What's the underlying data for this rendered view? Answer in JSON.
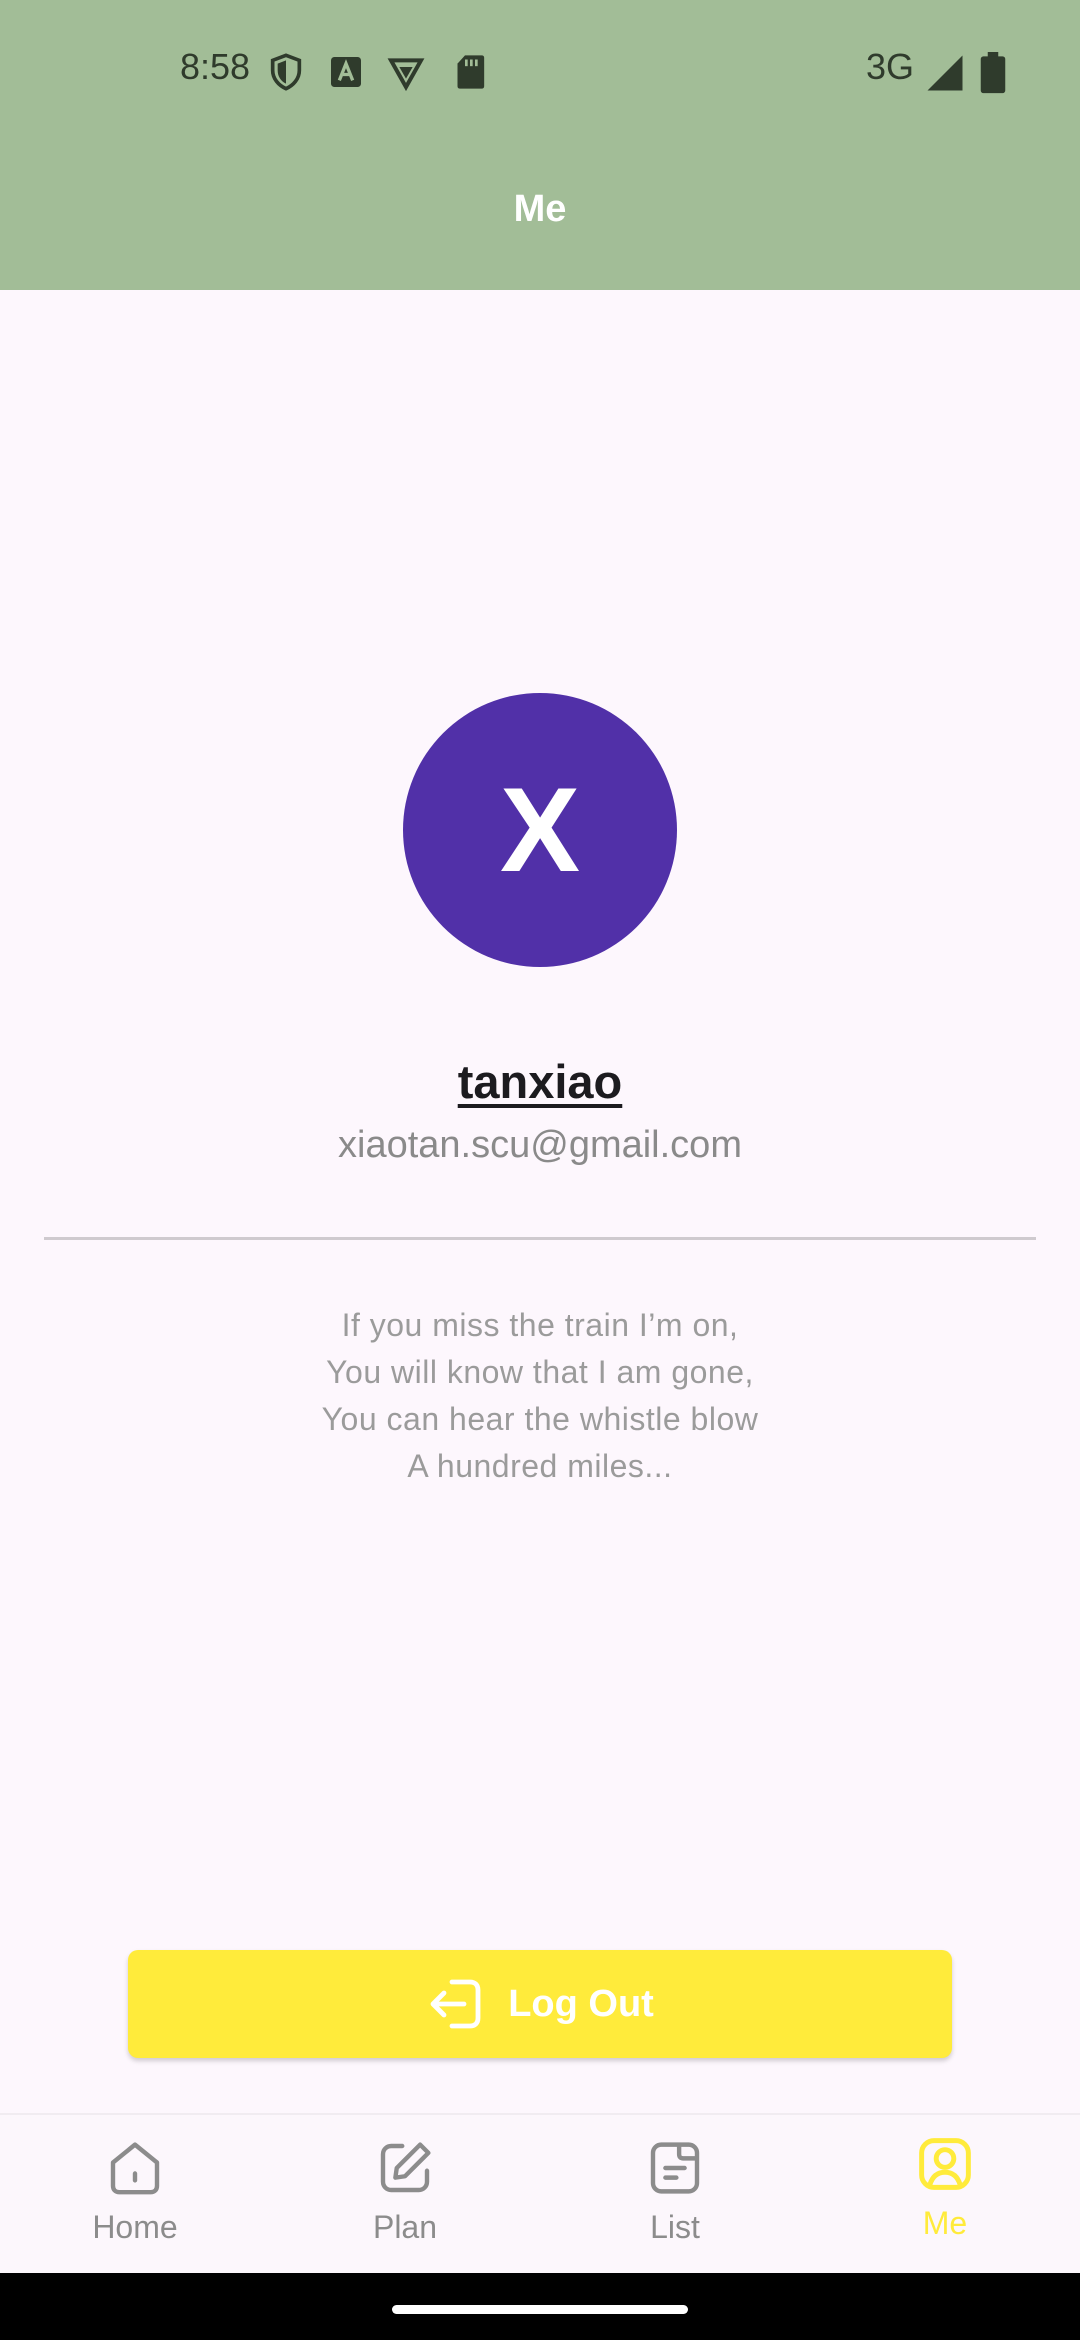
{
  "status_bar": {
    "time": "8:58",
    "network": "3G",
    "icons": [
      "shield-icon",
      "a-badge-icon",
      "vpn-icon",
      "sd-card-icon",
      "signal-icon",
      "battery-icon"
    ]
  },
  "app_bar": {
    "title": "Me"
  },
  "profile": {
    "avatar_letter": "X",
    "avatar_color": "#5130a8",
    "username": "tanxiao",
    "email": "xiaotan.scu@gmail.com"
  },
  "quote": {
    "lines": [
      "If you miss the train I’m on,",
      "You will know that I am gone,",
      "You can hear the whistle blow",
      "A hundred miles..."
    ]
  },
  "logout": {
    "label": "Log Out",
    "icon": "logout-icon",
    "color": "#ffeb3b"
  },
  "bottom_nav": {
    "items": [
      {
        "label": "Home",
        "icon": "home-icon"
      },
      {
        "label": "Plan",
        "icon": "edit-icon"
      },
      {
        "label": "List",
        "icon": "list-icon"
      },
      {
        "label": "Me",
        "icon": "profile-icon"
      }
    ],
    "active": "Me",
    "active_color": "#ffeb3b"
  },
  "colors": {
    "top_bar": "#a2bd97",
    "background": "#fdf7fd"
  }
}
